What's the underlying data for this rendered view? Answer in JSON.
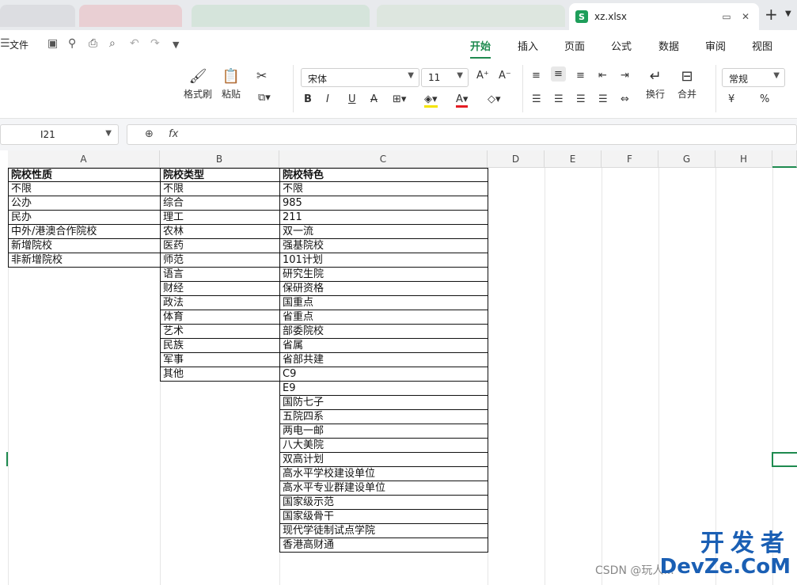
{
  "window": {
    "active_tab_icon": "S",
    "active_tab_title": "xz.xlsx",
    "new_tab": "+"
  },
  "menu": {
    "file": "文件",
    "tabs": [
      "开始",
      "插入",
      "页面",
      "公式",
      "数据",
      "审阅",
      "视图"
    ],
    "active_tab": "开始"
  },
  "ribbon": {
    "format_painter": "格式刷",
    "paste": "粘贴",
    "font_name": "宋体",
    "font_size": "11",
    "wrap": "换行",
    "merge": "合并",
    "number_format": "常规",
    "currency_symbol": "¥",
    "percent_symbol": "%"
  },
  "formula_bar": {
    "cell_ref": "I21",
    "fx_label": "fx",
    "value": ""
  },
  "columns": [
    "A",
    "B",
    "C",
    "D",
    "E",
    "F",
    "G",
    "H"
  ],
  "sheet": {
    "col_a_header": "院校性质",
    "col_a": [
      "不限",
      "公办",
      "民办",
      "中外/港澳合作院校",
      "新增院校",
      "非新增院校"
    ],
    "col_b_header": "院校类型",
    "col_b": [
      "不限",
      "综合",
      "理工",
      "农林",
      "医药",
      "师范",
      "语言",
      "财经",
      "政法",
      "体育",
      "艺术",
      "民族",
      "军事",
      "其他"
    ],
    "col_c_header": "院校特色",
    "col_c": [
      "不限",
      "985",
      "211",
      "双一流",
      "强基院校",
      "101计划",
      "研究生院",
      "保研资格",
      "国重点",
      "省重点",
      "部委院校",
      "省属",
      "省部共建",
      "C9",
      "E9",
      "国防七子",
      "五院四系",
      "两电一邮",
      "八大美院",
      "双高计划",
      "高水平学校建设单位",
      "高水平专业群建设单位",
      "国家级示范",
      "国家级骨干",
      "现代学徒制试点学院",
      "香港高财通"
    ]
  },
  "watermark": {
    "brand_cn": "开发者",
    "brand_en": "DevZe.CoM",
    "csdn": "CSDN @玩人..."
  }
}
